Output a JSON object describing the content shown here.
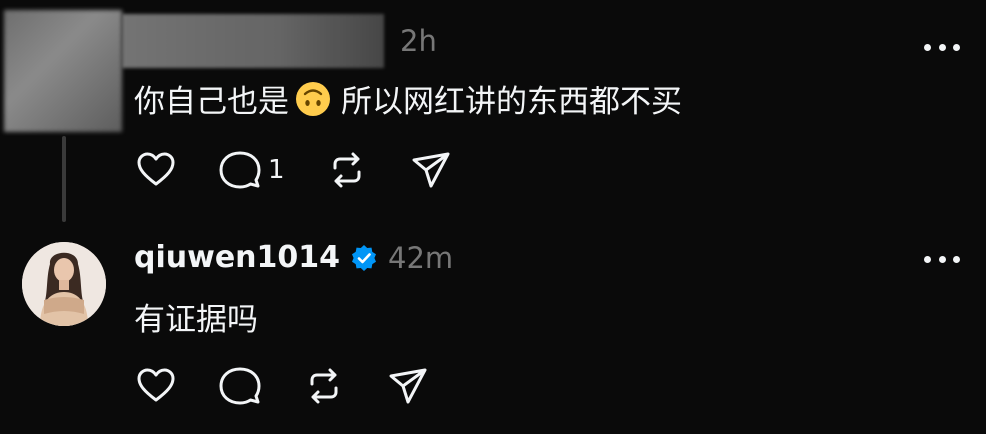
{
  "post1": {
    "time": "2h",
    "text_before_emoji": "你自己也是",
    "emoji": "upside-down-face-emoji",
    "text_after_emoji": "所以网红讲的东西都不买",
    "reply_count": "1"
  },
  "post2": {
    "username": "qiuwen1014",
    "time": "42m",
    "text": "有证据吗"
  },
  "colors": {
    "background": "#0a0a0a",
    "text": "#f3f5f7",
    "muted": "#777777",
    "verified": "#0095f6"
  },
  "icons": [
    "heart-icon",
    "comment-icon",
    "repost-icon",
    "share-icon",
    "more-icon",
    "verified-icon"
  ]
}
